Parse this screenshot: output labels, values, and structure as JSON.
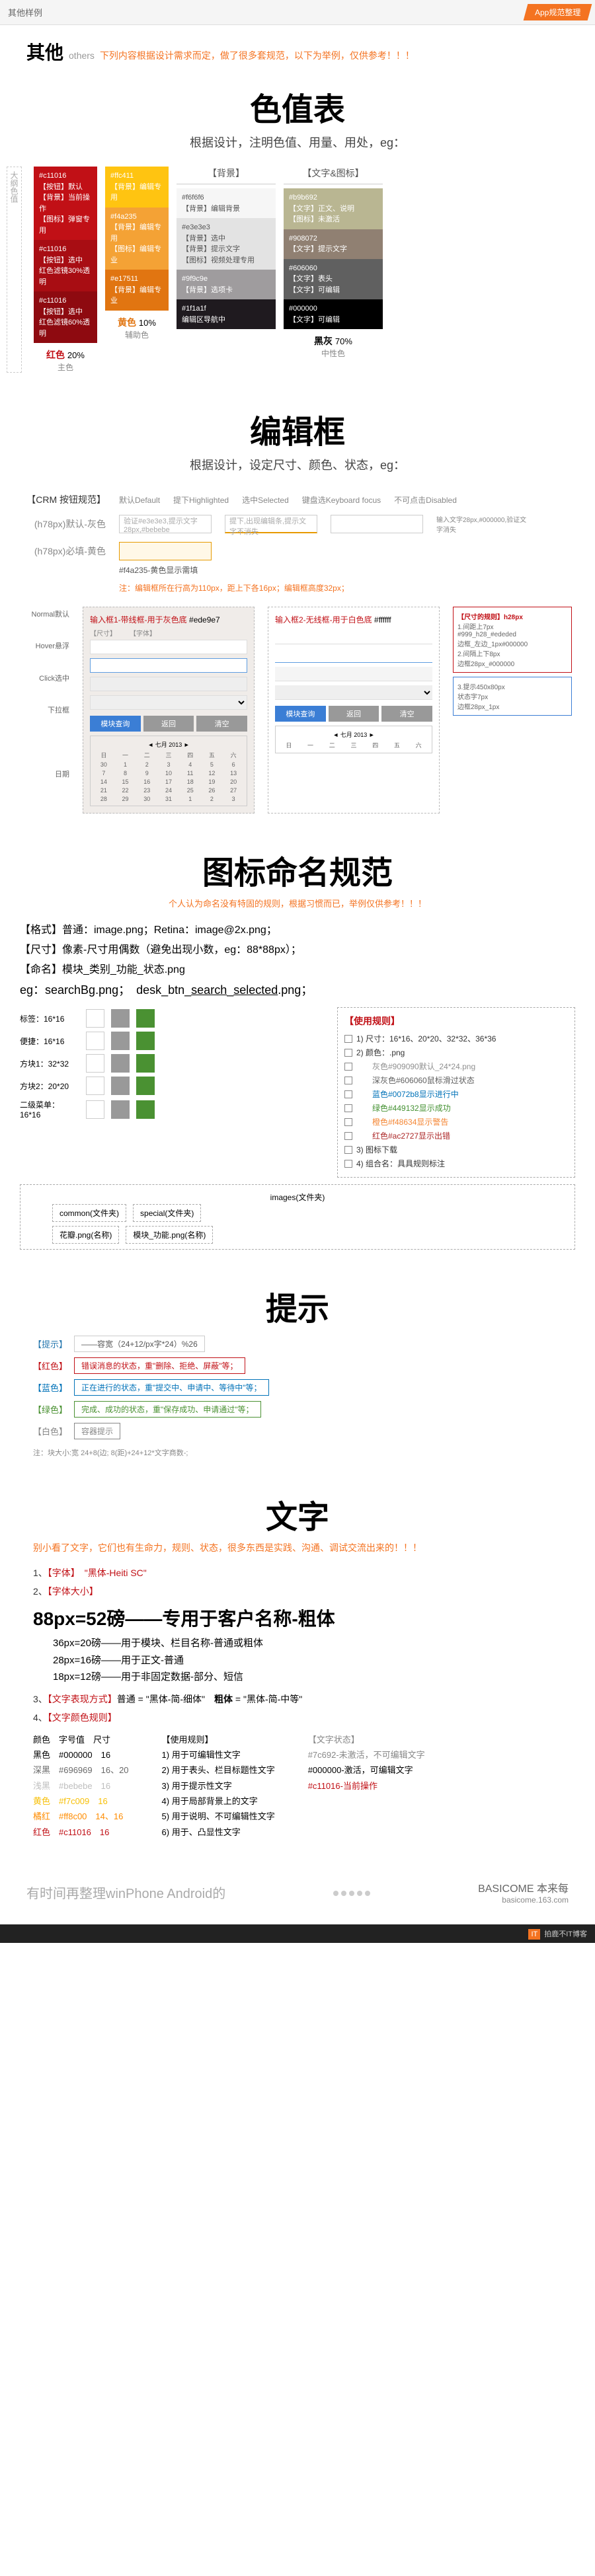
{
  "header": {
    "left": "其他样例",
    "right": "App规范整理"
  },
  "intro": {
    "cn": "其他",
    "en": "others",
    "note": "下列内容根据设计需求而定，做了很多套规范，以下为举例，仅供参考！！！"
  },
  "colorTable": {
    "title": "色值表",
    "sub": "根据设计，注明色值、用量、用处，eg：",
    "sideLabel": "大纲色值",
    "col1": [
      {
        "hex": "#c11016",
        "bg": "#c11016",
        "lines": [
          "【按钮】默认",
          "【背景】当前操作",
          "【图标】弹窗专用"
        ]
      },
      {
        "hex": "#c11016",
        "bg": "#a80d13",
        "lines": [
          "【按钮】选中",
          "红色滤镜30%透明"
        ]
      },
      {
        "hex": "#c11016",
        "bg": "#8e0a10",
        "lines": [
          "【按钮】选中",
          "红色滤镜60%透明"
        ]
      }
    ],
    "col1foot": {
      "name": "红色",
      "pct": "20%",
      "sub": "主色"
    },
    "col2": [
      {
        "hex": "#ffc411",
        "bg": "#ffc411",
        "lines": [
          "【背景】编辑专用"
        ]
      },
      {
        "hex": "#f4a235",
        "bg": "#f4a235",
        "lines": [
          "【背景】编辑专用",
          "【图标】编辑专业"
        ]
      },
      {
        "hex": "#e17511",
        "bg": "#e17511",
        "lines": [
          "【背景】编辑专业"
        ]
      }
    ],
    "col2foot": {
      "name": "黄色",
      "pct": "10%",
      "sub": "辅助色"
    },
    "headBg": "【背景】",
    "col3": [
      {
        "hex": "#f6f6f6",
        "bg": "#f6f6f6",
        "fg": "#555",
        "lines": [
          "【背景】编辑背景"
        ]
      },
      {
        "hex": "#e3e3e3",
        "bg": "#e3e3e3",
        "fg": "#555",
        "lines": [
          "【背景】选中",
          "【背景】提示文字",
          "【图标】视频处理专用"
        ]
      },
      {
        "hex": "#9f9c9e",
        "bg": "#9f9c9e",
        "lines": [
          "【背景】选项卡"
        ]
      },
      {
        "hex": "#1f1a1f",
        "bg": "#1f1a1f",
        "lines": [
          "编辑区导航中"
        ]
      }
    ],
    "headTxt": "【文字&图标】",
    "col4": [
      {
        "hex": "#b9b692",
        "bg": "#b9b692",
        "lines": [
          "【文字】正文、说明",
          "【图标】未激活"
        ]
      },
      {
        "hex": "#908072",
        "bg": "#908072",
        "lines": [
          "【文字】提示文字"
        ]
      },
      {
        "hex": "#606060",
        "bg": "#606060",
        "lines": [
          "【文字】表头",
          "【文字】可编辑"
        ]
      },
      {
        "hex": "#000000",
        "bg": "#000000",
        "lines": [
          "【文字】可编辑"
        ]
      }
    ],
    "col4foot": {
      "name": "黑灰",
      "pct": "70%",
      "sub": "中性色"
    }
  },
  "editBox": {
    "title": "编辑框",
    "sub": "根据设计，设定尺寸、颜色、状态，eg：",
    "crm": "【CRM 按钮规范】",
    "states": [
      "默认Default",
      "提下Highlighted",
      "选中Selected",
      "键盘选Keyboard focus",
      "不可点击Disabled"
    ],
    "r1": "(h78px)默认-灰色",
    "r1note": "验证#e3e3e3,提示文字28px,#bebebe",
    "r1note2": "提下,出现编辑条,提示文字不消失",
    "r1note3": "输入文字28px,#000000,验证文字消失",
    "r2": "(h78px)必填-黄色",
    "r2hex": "#f4a235-黄色显示需填",
    "note": "注：编辑框所在行高为110px，距上下各16px；编辑框高度32px；",
    "form1": {
      "title": "输入框1-带线框-用于灰色底",
      "bg": "#ede9e7",
      "btns": [
        "模块查询",
        "返回",
        "清空"
      ]
    },
    "form2": {
      "title": "输入框2-无线框-用于白色底",
      "bg": "#ffffff"
    },
    "labels": [
      "【尺寸】",
      "【字体】",
      "Normal默认",
      "Hover悬浮",
      "Click选中",
      "下拉框",
      "日期"
    ],
    "sideTitle": "【尺寸的规则】h28px",
    "sideLines": [
      "1.间距上7px",
      "#999_h28_#ededed",
      "边框_左边_1px#000000",
      "2.间隔上下8px",
      "边框28px_#000000",
      "3.提示450x80px",
      "状态字7px",
      "边框28px_1px"
    ]
  },
  "iconNaming": {
    "title": "图标命名规范",
    "note": "个人认为命名没有特固的规则，根据习惯而已，举例仅供参考！！！",
    "l1": "【格式】普通：image.png；Retina：image@2x.png；",
    "l2": "【尺寸】像素-尺寸用偶数（避免出现小数，eg：88*88px）；",
    "l3": "【命名】模块_类别_功能_状态.png",
    "eg": "eg：searchBg.png；　desk_btn_search_selected.png；",
    "leftRows": [
      {
        "label": "标签：16*16"
      },
      {
        "label": "便捷：16*16"
      },
      {
        "label": "方块1：32*32"
      },
      {
        "label": "方块2：20*20"
      },
      {
        "label": "二级菜单：16*16"
      }
    ],
    "rightTitle": "【使用规则】",
    "rightLi": [
      "1) 尺寸：16*16、20*20、32*32、36*36",
      "2) 颜色：.png",
      "　　灰色#909090默认_24*24.png",
      "　　深灰色#606060鼠标滑过状态",
      "　　蓝色#0072b8显示进行中",
      "　　绿色#449132显示成功",
      "　　橙色#f48634显示警告",
      "　　红色#ac2727显示出错",
      "3) 图标下载",
      "4) 组合名：具具规则标注"
    ],
    "tree": {
      "root": "images(文件夹)",
      "common": "common(文件夹)",
      "special": "special(文件夹)",
      "l": "花瓣.png(名称)",
      "r": "模块_功能.png(名称)"
    }
  },
  "tips": {
    "title": "提示",
    "rows": [
      {
        "lab": "【提示】",
        "txt": "——容宽（24+12/px字*24）%26"
      },
      {
        "lab": "【红色】",
        "txt": "错误消息的状态，重\"删除、拒绝、屏蔽\"等；",
        "color": "#c11016"
      },
      {
        "lab": "【蓝色】",
        "txt": "正在进行的状态，重\"提交中、申请中、等待中\"等；",
        "color": "#0072b8"
      },
      {
        "lab": "【绿色】",
        "txt": "完成、成功的状态，重\"保存成功、申请通过\"等；",
        "color": "#4a9132"
      },
      {
        "lab": "【白色】",
        "txt": "容器提示",
        "color": "#888"
      }
    ],
    "foot": "注：块大小:宽 24+8(边; 8(距)+24+12*文字商数-;"
  },
  "text": {
    "title": "文字",
    "note": "别小看了文字，它们也有生命力，规则、状态，很多东西是实践、沟通、调试交流出来的！！！",
    "li1": "【字体】　\"黑体-Heiti SC\"",
    "li2": "【字体大小】",
    "big": "88px=52磅——专用于客户名称-粗体",
    "sizes": [
      "36px=20磅——用于模块、栏目名称-普通或粗体",
      "28px=16磅——用于正文-普通",
      "18px=12磅——用于非固定数据-部分、短信"
    ],
    "li3": "【文字表现方式】普通 = \"黑体-简-细体\"　粗体 = \"黑体-简-中等\"",
    "li4": "【文字颜色规则】",
    "colorCols": {
      "c1": [
        "颜色　字号值　尺寸",
        "黑色　#000000　16",
        "深黑　#696969　16、20",
        "浅黑　#bebebe　16",
        "黄色　#f7c009　16",
        "橘红　#ff8c00　14、16",
        "红色　#c11016　16"
      ],
      "c2": [
        "【使用规则】",
        "1) 用于可编辑性文字",
        "2) 用于表头、栏目标题性文字",
        "3) 用于提示性文字",
        "4) 用于局部背景上的文字",
        "5) 用于说明、不可编辑性文字",
        "6) 用于、凸显性文字"
      ],
      "c3": [
        "【文字状态】",
        "#7c692-未激活，不可编辑文字",
        "#000000-激活，可编辑文字",
        "#c11016-当前操作"
      ]
    }
  },
  "footer": {
    "left": "有时间再整理winPhone  Android的",
    "brand": "BASICOME 本来每",
    "sub": "basicome.163.com"
  },
  "bottomBar": "拍鹿不IT博客"
}
